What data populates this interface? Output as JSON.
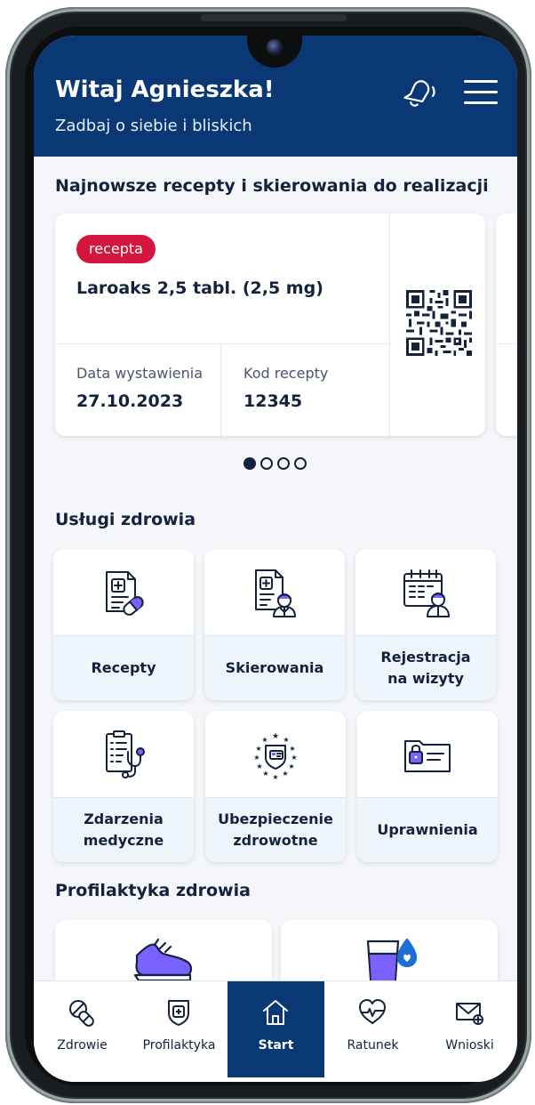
{
  "header": {
    "greeting": "Witaj Agnieszka!",
    "subtitle": "Zadbaj o siebie i bliskich",
    "bell_icon": "bell-icon",
    "menu_icon": "hamburger-menu-icon"
  },
  "prescriptions": {
    "section_title": "Najnowsze recepty i skierowania do realizacji",
    "card": {
      "badge": "recepta",
      "drug_name": "Laroaks 2,5 tabl. (2,5 mg)",
      "issue_date_label": "Data wystawienia",
      "issue_date": "27.10.2023",
      "code_label": "Kod recepty",
      "code": "12345",
      "qr_icon": "qr-code-icon"
    },
    "pagination": {
      "total": 4,
      "current": 1
    }
  },
  "health_services": {
    "section_title": "Usługi zdrowia",
    "tiles": [
      {
        "label": "Recepty",
        "icon": "prescription-pills-icon"
      },
      {
        "label": "Skierowania",
        "icon": "referral-doctor-icon"
      },
      {
        "label": "Rejestracja\nna wizyty",
        "icon": "calendar-doctor-icon"
      },
      {
        "label": "Zdarzenia\nmedyczne",
        "icon": "medical-record-stethoscope-icon"
      },
      {
        "label": "Ubezpieczenie\nzdrowotne",
        "icon": "eu-insurance-card-icon"
      },
      {
        "label": "Uprawnienia",
        "icon": "locked-folder-icon"
      }
    ]
  },
  "prophylaxis": {
    "section_title": "Profilaktyka zdrowia",
    "cards": [
      {
        "icon": "sneaker-icon"
      },
      {
        "icon": "glass-water-drop-icon"
      }
    ]
  },
  "bottom_nav": {
    "items": [
      {
        "label": "Zdrowie",
        "icon": "pill-capsule-icon"
      },
      {
        "label": "Profilaktyka",
        "icon": "shield-cross-icon"
      },
      {
        "label": "Start",
        "icon": "home-icon",
        "active": true
      },
      {
        "label": "Ratunek",
        "icon": "heart-pulse-icon"
      },
      {
        "label": "Wnioski",
        "icon": "envelope-plus-icon"
      }
    ]
  },
  "colors": {
    "primary_navy": "#0a3874",
    "badge_red": "#d4163c",
    "text_dark": "#13223d",
    "tile_label_bg": "#eef5fb",
    "icon_accent_purple": "#7b61ff",
    "icon_accent_blue": "#1d6fd6"
  }
}
